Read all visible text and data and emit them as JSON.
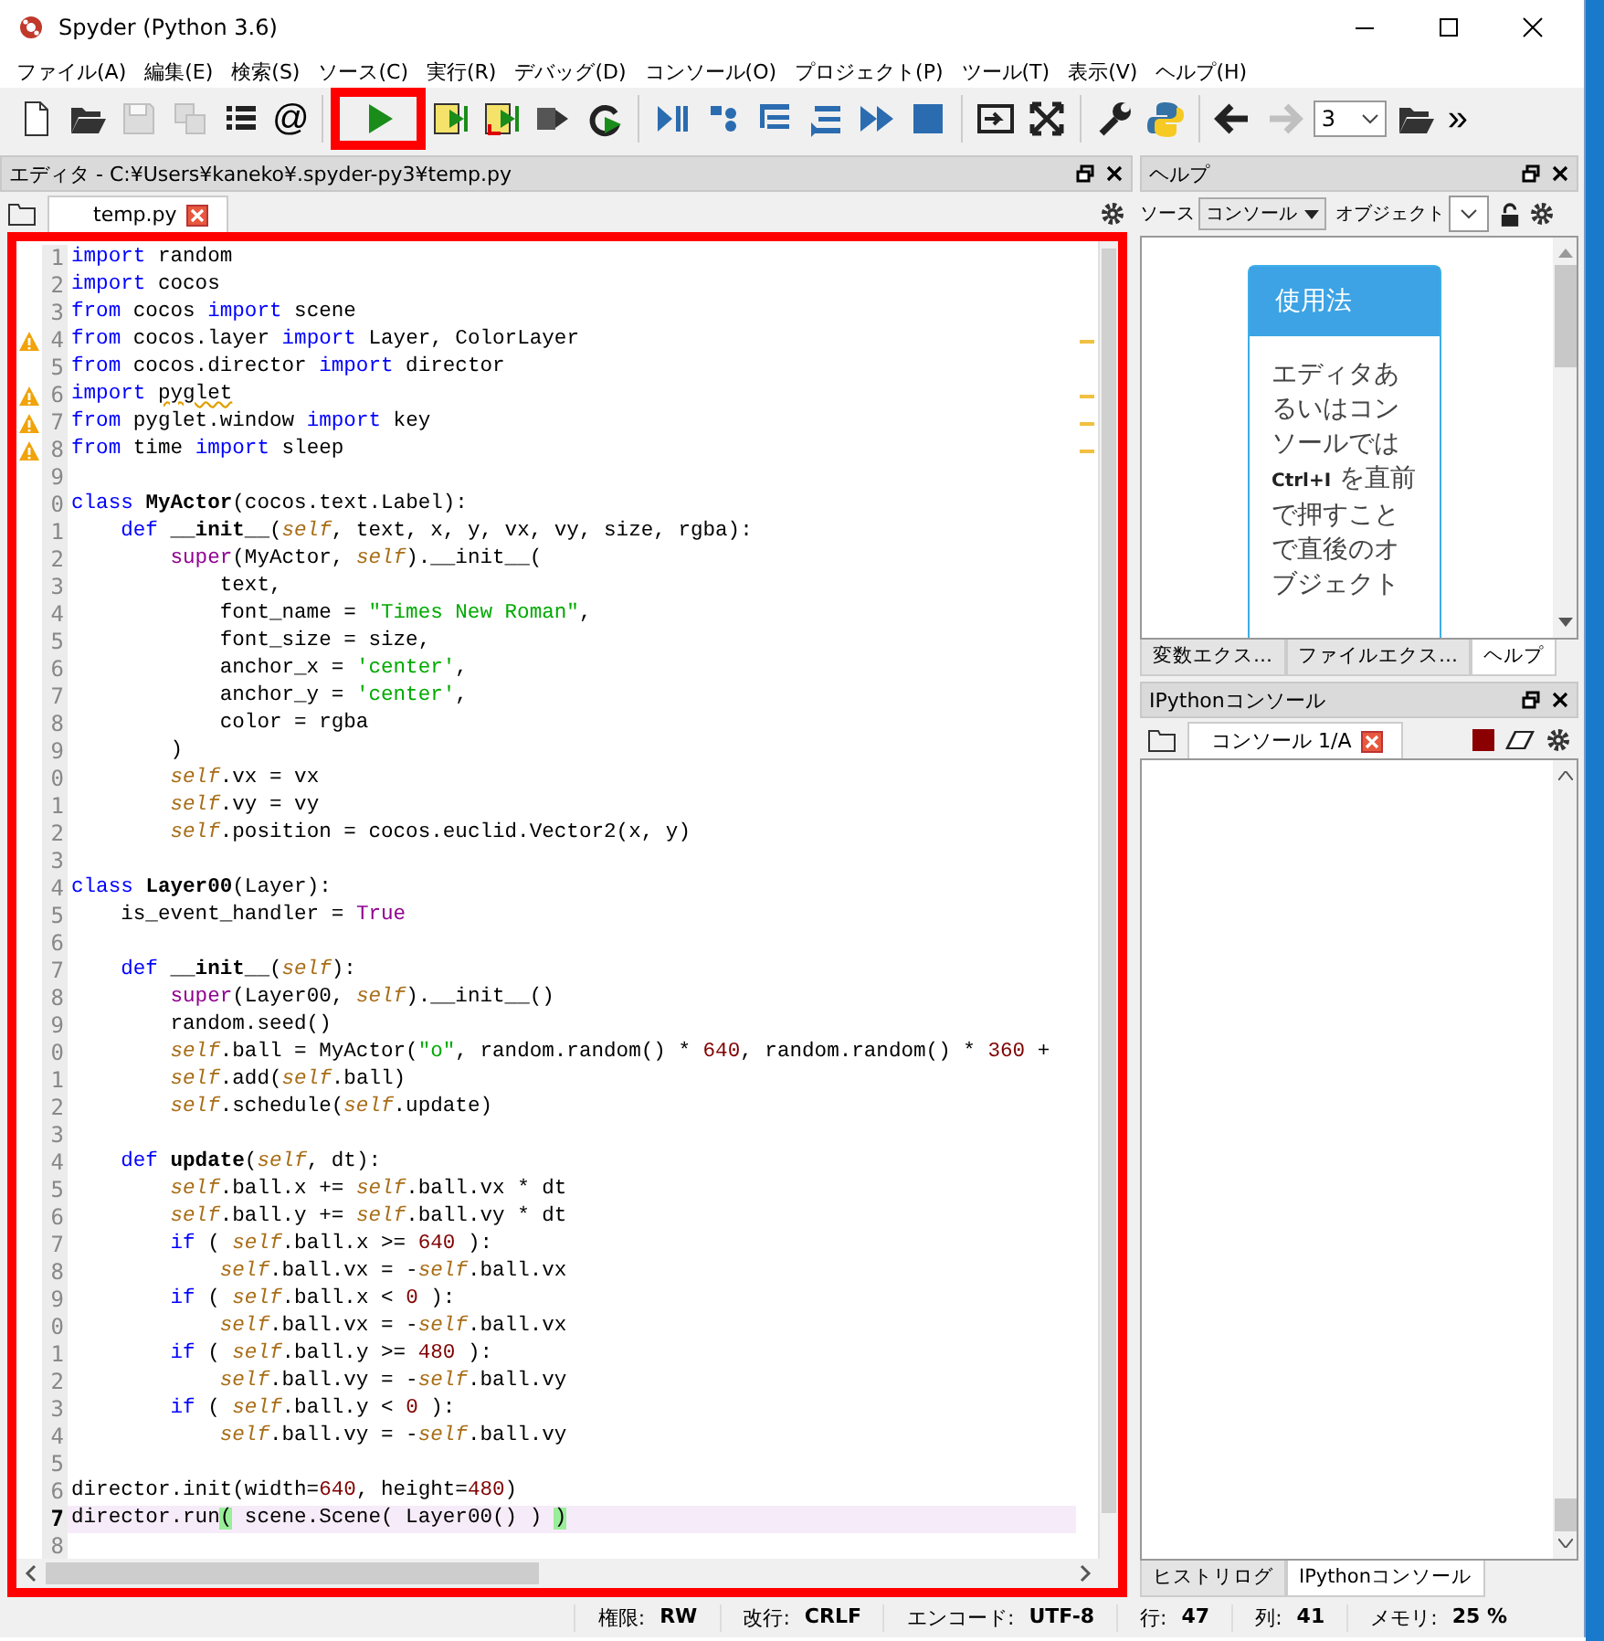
{
  "window": {
    "title": "Spyder (Python 3.6)"
  },
  "menu": [
    "ファイル(A)",
    "編集(E)",
    "検索(S)",
    "ソース(C)",
    "実行(R)",
    "デバッグ(D)",
    "コンソール(O)",
    "プロジェクト(P)",
    "ツール(T)",
    "表示(V)",
    "ヘルプ(H)"
  ],
  "toolbar": [
    [
      {
        "kind": "new-file",
        "disabled": false
      },
      {
        "kind": "open-folder",
        "disabled": false
      },
      {
        "kind": "save",
        "disabled": true
      },
      {
        "kind": "save-all",
        "disabled": true
      },
      {
        "kind": "list",
        "disabled": false
      },
      {
        "kind": "glyph",
        "text": "@",
        "disabled": false
      }
    ],
    [
      {
        "kind": "run",
        "disabled": false,
        "highlighted": true
      },
      {
        "kind": "run-cell",
        "disabled": false
      },
      {
        "kind": "run-cell-advance",
        "disabled": false
      },
      {
        "kind": "run-selection",
        "disabled": false
      },
      {
        "kind": "rerun",
        "disabled": false
      }
    ],
    [
      {
        "kind": "debug",
        "disabled": false
      },
      {
        "kind": "step",
        "disabled": false
      },
      {
        "kind": "step-into",
        "disabled": false
      },
      {
        "kind": "step-return",
        "disabled": false
      },
      {
        "kind": "continue",
        "disabled": false
      },
      {
        "kind": "stop",
        "disabled": false
      }
    ],
    [
      {
        "kind": "maximize",
        "disabled": false
      },
      {
        "kind": "fullscreen",
        "disabled": false
      }
    ],
    [
      {
        "kind": "wrench",
        "disabled": false
      },
      {
        "kind": "python",
        "disabled": false
      }
    ],
    [
      {
        "kind": "back",
        "disabled": false
      },
      {
        "kind": "forward",
        "disabled": true
      },
      {
        "kind": "combo",
        "text": "3",
        "disabled": false
      },
      {
        "kind": "open-folder",
        "disabled": false
      },
      {
        "kind": "glyph",
        "text": "»",
        "disabled": false
      }
    ]
  ],
  "editor": {
    "title": "エディタ - C:¥Users¥kaneko¥.spyder-py3¥temp.py",
    "tabs": [
      {
        "label": "temp.py",
        "selected": true
      }
    ],
    "highlighted": true,
    "lines": [
      {
        "number": "1",
        "tokens": [
          {
            "kind": "kw",
            "text": "import"
          },
          {
            "kind": "plain",
            "text": " random"
          }
        ]
      },
      {
        "number": "2",
        "tokens": [
          {
            "kind": "kw",
            "text": "import"
          },
          {
            "kind": "plain",
            "text": " cocos"
          }
        ]
      },
      {
        "number": "3",
        "tokens": [
          {
            "kind": "kw",
            "text": "from"
          },
          {
            "kind": "plain",
            "text": " cocos "
          },
          {
            "kind": "kw",
            "text": "import"
          },
          {
            "kind": "plain",
            "text": " scene"
          }
        ]
      },
      {
        "number": "4",
        "warning": true,
        "tokens": [
          {
            "kind": "kw",
            "text": "from"
          },
          {
            "kind": "plain",
            "text": " cocos.layer "
          },
          {
            "kind": "kw",
            "text": "import"
          },
          {
            "kind": "plain",
            "text": " Layer, ColorLayer"
          }
        ]
      },
      {
        "number": "5",
        "tokens": [
          {
            "kind": "kw",
            "text": "from"
          },
          {
            "kind": "plain",
            "text": " cocos.director "
          },
          {
            "kind": "kw",
            "text": "import"
          },
          {
            "kind": "plain",
            "text": " director"
          }
        ]
      },
      {
        "number": "6",
        "warning": true,
        "tokens": [
          {
            "kind": "kw",
            "text": "import "
          },
          {
            "kind": "squiggle",
            "text": "pyglet"
          }
        ]
      },
      {
        "number": "7",
        "warning": true,
        "tokens": [
          {
            "kind": "kw",
            "text": "from"
          },
          {
            "kind": "plain",
            "text": " pyglet.window "
          },
          {
            "kind": "kw",
            "text": "import"
          },
          {
            "kind": "plain",
            "text": " key"
          }
        ]
      },
      {
        "number": "8",
        "warning": true,
        "tokens": [
          {
            "kind": "kw",
            "text": "from"
          },
          {
            "kind": "plain",
            "text": " time "
          },
          {
            "kind": "kw",
            "text": "import"
          },
          {
            "kind": "plain",
            "text": " sleep"
          }
        ]
      },
      {
        "number": "9"
      },
      {
        "number": "0",
        "tokens": [
          {
            "kind": "kw",
            "text": "class "
          },
          {
            "kind": "name",
            "text": "MyActor"
          },
          {
            "kind": "plain",
            "text": "(cocos.text.Label):"
          }
        ]
      },
      {
        "number": "1",
        "tokens": [
          {
            "kind": "kw",
            "text": "    def "
          },
          {
            "kind": "name",
            "text": "__init__"
          },
          {
            "kind": "plain",
            "text": "("
          },
          {
            "kind": "self",
            "text": "self"
          },
          {
            "kind": "plain",
            "text": ", text, x, y, vx, vy, size, rgba):"
          }
        ]
      },
      {
        "number": "2",
        "tokens": [
          {
            "kind": "builtin",
            "text": "        super"
          },
          {
            "kind": "plain",
            "text": "(MyActor, "
          },
          {
            "kind": "self",
            "text": "self"
          },
          {
            "kind": "plain",
            "text": ").__init__("
          }
        ]
      },
      {
        "number": "3",
        "tokens": [
          {
            "kind": "plain",
            "text": "            text,"
          }
        ]
      },
      {
        "number": "4",
        "tokens": [
          {
            "kind": "plain",
            "text": "            font_name = "
          },
          {
            "kind": "str",
            "text": "\"Times New Roman\""
          },
          {
            "kind": "plain",
            "text": ","
          }
        ]
      },
      {
        "number": "5",
        "tokens": [
          {
            "kind": "plain",
            "text": "            font_size = size,"
          }
        ]
      },
      {
        "number": "6",
        "tokens": [
          {
            "kind": "plain",
            "text": "            anchor_x = "
          },
          {
            "kind": "str",
            "text": "'center'"
          },
          {
            "kind": "plain",
            "text": ","
          }
        ]
      },
      {
        "number": "7",
        "tokens": [
          {
            "kind": "plain",
            "text": "            anchor_y = "
          },
          {
            "kind": "str",
            "text": "'center'"
          },
          {
            "kind": "plain",
            "text": ","
          }
        ]
      },
      {
        "number": "8",
        "tokens": [
          {
            "kind": "plain",
            "text": "            color = rgba"
          }
        ]
      },
      {
        "number": "9",
        "tokens": [
          {
            "kind": "plain",
            "text": "        )"
          }
        ]
      },
      {
        "number": "0",
        "tokens": [
          {
            "kind": "self",
            "text": "        self"
          },
          {
            "kind": "plain",
            "text": ".vx = vx"
          }
        ]
      },
      {
        "number": "1",
        "tokens": [
          {
            "kind": "self",
            "text": "        self"
          },
          {
            "kind": "plain",
            "text": ".vy = vy"
          }
        ]
      },
      {
        "number": "2",
        "tokens": [
          {
            "kind": "self",
            "text": "        self"
          },
          {
            "kind": "plain",
            "text": ".position = cocos.euclid.Vector2(x, y)"
          }
        ]
      },
      {
        "number": "3"
      },
      {
        "number": "4",
        "tokens": [
          {
            "kind": "kw",
            "text": "class "
          },
          {
            "kind": "name",
            "text": "Layer00"
          },
          {
            "kind": "plain",
            "text": "(Layer):"
          }
        ]
      },
      {
        "number": "5",
        "tokens": [
          {
            "kind": "plain",
            "text": "    is_event_handler = "
          },
          {
            "kind": "builtin",
            "text": "True"
          }
        ]
      },
      {
        "number": "6"
      },
      {
        "number": "7",
        "tokens": [
          {
            "kind": "kw",
            "text": "    def "
          },
          {
            "kind": "name",
            "text": "__init__"
          },
          {
            "kind": "plain",
            "text": "("
          },
          {
            "kind": "self",
            "text": "self"
          },
          {
            "kind": "plain",
            "text": "):"
          }
        ]
      },
      {
        "number": "8",
        "tokens": [
          {
            "kind": "builtin",
            "text": "        super"
          },
          {
            "kind": "plain",
            "text": "(Layer00, "
          },
          {
            "kind": "self",
            "text": "self"
          },
          {
            "kind": "plain",
            "text": ").__init__()"
          }
        ]
      },
      {
        "number": "9",
        "tokens": [
          {
            "kind": "plain",
            "text": "        random.seed()"
          }
        ]
      },
      {
        "number": "0",
        "tokens": [
          {
            "kind": "self",
            "text": "        self"
          },
          {
            "kind": "plain",
            "text": ".ball = MyActor("
          },
          {
            "kind": "str",
            "text": "\"o\""
          },
          {
            "kind": "plain",
            "text": ", random.random() * "
          },
          {
            "kind": "num",
            "text": "640"
          },
          {
            "kind": "plain",
            "text": ", random.random() * "
          },
          {
            "kind": "num",
            "text": "360"
          },
          {
            "kind": "plain",
            "text": " +"
          }
        ]
      },
      {
        "number": "1",
        "tokens": [
          {
            "kind": "self",
            "text": "        self"
          },
          {
            "kind": "plain",
            "text": ".add("
          },
          {
            "kind": "self",
            "text": "self"
          },
          {
            "kind": "plain",
            "text": ".ball)"
          }
        ]
      },
      {
        "number": "2",
        "tokens": [
          {
            "kind": "self",
            "text": "        self"
          },
          {
            "kind": "plain",
            "text": ".schedule("
          },
          {
            "kind": "self",
            "text": "self"
          },
          {
            "kind": "plain",
            "text": ".update)"
          }
        ]
      },
      {
        "number": "3"
      },
      {
        "number": "4",
        "tokens": [
          {
            "kind": "kw",
            "text": "    def "
          },
          {
            "kind": "name",
            "text": "update"
          },
          {
            "kind": "plain",
            "text": "("
          },
          {
            "kind": "self",
            "text": "self"
          },
          {
            "kind": "plain",
            "text": ", dt):"
          }
        ]
      },
      {
        "number": "5",
        "tokens": [
          {
            "kind": "self",
            "text": "        self"
          },
          {
            "kind": "plain",
            "text": ".ball.x += "
          },
          {
            "kind": "self",
            "text": "self"
          },
          {
            "kind": "plain",
            "text": ".ball.vx * dt"
          }
        ]
      },
      {
        "number": "6",
        "tokens": [
          {
            "kind": "self",
            "text": "        self"
          },
          {
            "kind": "plain",
            "text": ".ball.y += "
          },
          {
            "kind": "self",
            "text": "self"
          },
          {
            "kind": "plain",
            "text": ".ball.vy * dt"
          }
        ]
      },
      {
        "number": "7",
        "tokens": [
          {
            "kind": "kw",
            "text": "        if"
          },
          {
            "kind": "plain",
            "text": " ( "
          },
          {
            "kind": "self",
            "text": "self"
          },
          {
            "kind": "plain",
            "text": ".ball.x >= "
          },
          {
            "kind": "num",
            "text": "640"
          },
          {
            "kind": "plain",
            "text": " ):"
          }
        ]
      },
      {
        "number": "8",
        "tokens": [
          {
            "kind": "self",
            "text": "            self"
          },
          {
            "kind": "plain",
            "text": ".ball.vx = -"
          },
          {
            "kind": "self",
            "text": "self"
          },
          {
            "kind": "plain",
            "text": ".ball.vx"
          }
        ]
      },
      {
        "number": "9",
        "tokens": [
          {
            "kind": "kw",
            "text": "        if"
          },
          {
            "kind": "plain",
            "text": " ( "
          },
          {
            "kind": "self",
            "text": "self"
          },
          {
            "kind": "plain",
            "text": ".ball.x < "
          },
          {
            "kind": "num",
            "text": "0"
          },
          {
            "kind": "plain",
            "text": " ):"
          }
        ]
      },
      {
        "number": "0",
        "tokens": [
          {
            "kind": "self",
            "text": "            self"
          },
          {
            "kind": "plain",
            "text": ".ball.vx = -"
          },
          {
            "kind": "self",
            "text": "self"
          },
          {
            "kind": "plain",
            "text": ".ball.vx"
          }
        ]
      },
      {
        "number": "1",
        "tokens": [
          {
            "kind": "kw",
            "text": "        if"
          },
          {
            "kind": "plain",
            "text": " ( "
          },
          {
            "kind": "self",
            "text": "self"
          },
          {
            "kind": "plain",
            "text": ".ball.y >= "
          },
          {
            "kind": "num",
            "text": "480"
          },
          {
            "kind": "plain",
            "text": " ):"
          }
        ]
      },
      {
        "number": "2",
        "tokens": [
          {
            "kind": "self",
            "text": "            self"
          },
          {
            "kind": "plain",
            "text": ".ball.vy = -"
          },
          {
            "kind": "self",
            "text": "self"
          },
          {
            "kind": "plain",
            "text": ".ball.vy"
          }
        ]
      },
      {
        "number": "3",
        "tokens": [
          {
            "kind": "kw",
            "text": "        if"
          },
          {
            "kind": "plain",
            "text": " ( "
          },
          {
            "kind": "self",
            "text": "self"
          },
          {
            "kind": "plain",
            "text": ".ball.y < "
          },
          {
            "kind": "num",
            "text": "0"
          },
          {
            "kind": "plain",
            "text": " ):"
          }
        ]
      },
      {
        "number": "4",
        "tokens": [
          {
            "kind": "self",
            "text": "            self"
          },
          {
            "kind": "plain",
            "text": ".ball.vy = -"
          },
          {
            "kind": "self",
            "text": "self"
          },
          {
            "kind": "plain",
            "text": ".ball.vy"
          }
        ]
      },
      {
        "number": "5"
      },
      {
        "number": "6",
        "tokens": [
          {
            "kind": "plain",
            "text": "director.init(width="
          },
          {
            "kind": "num",
            "text": "640"
          },
          {
            "kind": "plain",
            "text": ", height="
          },
          {
            "kind": "num",
            "text": "480"
          },
          {
            "kind": "plain",
            "text": ")"
          }
        ]
      },
      {
        "number": "7",
        "current": true,
        "tokens": [
          {
            "kind": "plain",
            "text": "director.run"
          },
          {
            "kind": "match",
            "text": "("
          },
          {
            "kind": "plain",
            "text": " scene.Scene( Layer00() ) "
          },
          {
            "kind": "match",
            "text": ")"
          }
        ]
      },
      {
        "number": "8"
      }
    ]
  },
  "help": {
    "title": "ヘルプ",
    "source_label": "ソース",
    "source_value": "コンソール",
    "object_label": "オブジェクト",
    "card_title": "使用法",
    "card_text": "エディタあるいはコンソールでは **Ctrl+I** を直前で押すことで直後のオブジェクト",
    "tabs": [
      {
        "label": "変数エクス…",
        "selected": false
      },
      {
        "label": "ファイルエクス…",
        "selected": false
      },
      {
        "label": "ヘルプ",
        "selected": true
      }
    ]
  },
  "console": {
    "title": "IPythonコンソール",
    "tabs": [
      {
        "label": "コンソール 1/A",
        "selected": true
      }
    ],
    "bottom_tabs": [
      {
        "label": "ヒストリログ",
        "selected": false
      },
      {
        "label": "IPythonコンソール",
        "selected": true
      }
    ]
  },
  "status_bar": [
    {
      "label": "権限:",
      "value": "RW"
    },
    {
      "label": "改行:",
      "value": "CRLF"
    },
    {
      "label": "エンコード:",
      "value": "UTF-8"
    },
    {
      "label": "行:",
      "value": "47"
    },
    {
      "label": "列:",
      "value": "41"
    },
    {
      "label": "メモリ:",
      "value": "25 %"
    }
  ]
}
